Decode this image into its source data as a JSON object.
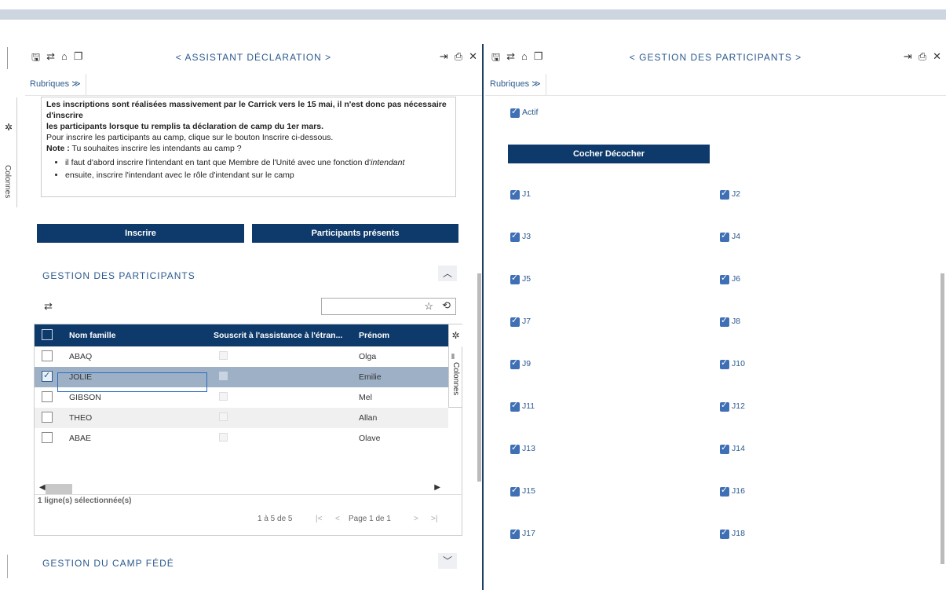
{
  "left_panel": {
    "title": "< ASSISTANT DÉCLARATION >",
    "rubriques": "Rubriques ≫",
    "notice": {
      "line1": "Les inscriptions sont réalisées massivement par le Carrick vers le 15 mai, il n'est donc pas nécessaire d'inscrire",
      "line2": "les participants lorsque tu remplis ta déclaration de camp du 1er mars.",
      "line3": "Pour inscrire les participants au camp, clique sur le bouton Inscrire ci-dessous.",
      "note_label": "Note :",
      "note_text": " Tu souhaites inscrire les intendants au camp ?",
      "bullet1_a": "il faut d'abord inscrire l'intendant en tant que Membre de l'Unité avec une fonction d'",
      "bullet1_b": "intendant",
      "bullet2": "ensuite, inscrire l'intendant avec le rôle d'intendant sur le camp"
    },
    "inscrire_btn": "Inscrire",
    "participants_btn": "Participants présents",
    "section_title": "GESTION DES PARTICIPANTS",
    "section2_title": "GESTION DU CAMP FÉDÉ",
    "grid": {
      "columns": [
        "Nom famille",
        "Souscrit à l'assistance à l'étran...",
        "Prénom"
      ],
      "rows": [
        {
          "nom": "ABAQ",
          "prenom": "Olga",
          "selected": false
        },
        {
          "nom": "JOLIE",
          "prenom": "Emilie",
          "selected": true
        },
        {
          "nom": "GIBSON",
          "prenom": "Mel",
          "selected": false
        },
        {
          "nom": "THEO",
          "prenom": "Allan",
          "selected": false
        },
        {
          "nom": "ABAE",
          "prenom": "Olave",
          "selected": false
        }
      ],
      "colonnes_label": "Colonnes",
      "selected_count": "1 ligne(s) sélectionnée(s)",
      "range": "1 à 5 de 5",
      "page": "Page 1 de 1"
    }
  },
  "right_panel": {
    "title": "< GESTION DES PARTICIPANTS >",
    "rubriques": "Rubriques ≫",
    "actif_label": "Actif",
    "toggle_btn": "Cocher Décocher",
    "days_left": [
      "J1",
      "J3",
      "J5",
      "J7",
      "J9",
      "J11",
      "J13",
      "J15",
      "J17"
    ],
    "days_right": [
      "J2",
      "J4",
      "J6",
      "J8",
      "J10",
      "J12",
      "J14",
      "J16",
      "J18"
    ]
  },
  "left_strip": {
    "colonnes": "Colonnes"
  },
  "colors": {
    "primary": "#0e3a6b",
    "accent": "#2b5a8e",
    "checkbox": "#3f6fb5",
    "selected_row": "#9db0c5"
  }
}
